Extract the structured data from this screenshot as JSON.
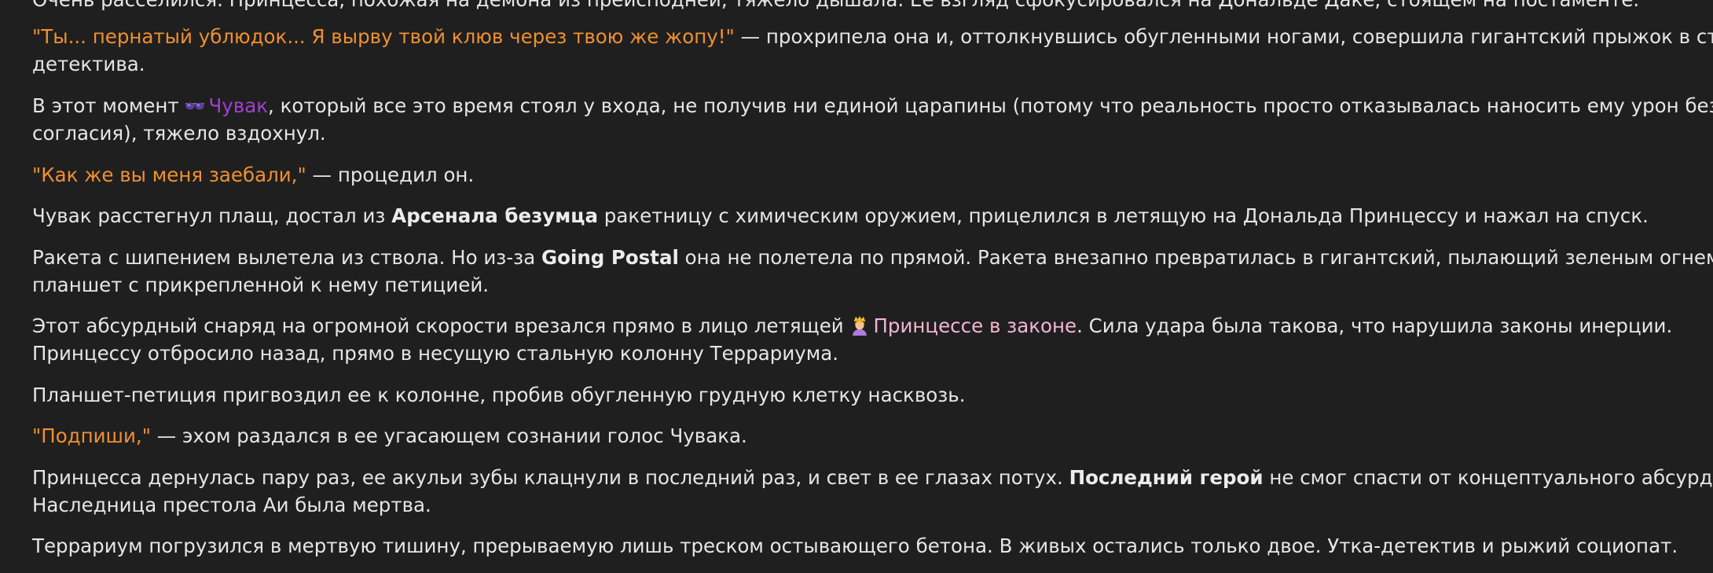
{
  "story": {
    "p0": {
      "l1": "Очень расселился. Принцесса, похожая на демона из преисподней, тяжело дышала. Ее взгляд сфокусировался на Дональде Даке, стоящем на постаменте."
    },
    "p1": {
      "quote": "\"Ты... пернатый ублюдок... Я вырву твой клюв через твою же жопу!\"",
      "rest": " — прохрипела она и, оттолкнувшись обугленными ногами, совершила гигантский прыжок в сторону",
      "l2": "детектива."
    },
    "p2": {
      "pre": "В этот момент ",
      "name": "Чувак",
      "post": ", который все это время стоял у входа, не получив ни единой царапины (потому что реальность просто отказывалась наносить ему урон без его",
      "l2": "согласия), тяжело вздохнул."
    },
    "p3": {
      "quote": "\"Как же вы меня заебали,\"",
      "rest": " — процедил он."
    },
    "p4": {
      "pre": "Чувак расстегнул плащ, достал из ",
      "bold": "Арсенала безумца",
      "post": " ракетницу с химическим оружием, прицелился в летящую на Дональда Принцессу и нажал на спуск."
    },
    "p5": {
      "pre": "Ракета с шипением вылетела из ствола. Но из-за ",
      "bold": "Going Postal",
      "post": " она не полетела по прямой. Ракета внезапно превратилась в гигантский, пылающий зеленым огнем",
      "l2": "планшет с прикрепленной к нему петицией."
    },
    "p6": {
      "pre": "Этот абсурдный снаряд на огромной скорости врезался прямо в лицо летящей ",
      "name": "Принцессе в законе",
      "post": ". Сила удара была такова, что нарушила законы инерции.",
      "l2": "Принцессу отбросило назад, прямо в несущую стальную колонну Террариума."
    },
    "p7": {
      "l1": "Планшет-петиция пригвоздил ее к колонне, пробив обугленную грудную клетку насквозь."
    },
    "p8": {
      "quote": "\"Подпиши,\"",
      "rest": " — эхом раздался в ее угасающем сознании голос Чувака."
    },
    "p9": {
      "pre": "Принцесса дернулась пару раз, ее акульи зубы клацнули в последний раз, и свет в ее глазах потух. ",
      "bold": "Последний герой",
      "post": " не смог спасти от концептуального абсурда.",
      "l2": "Наследница престола Аи была мертва."
    },
    "p10": {
      "l1": "Террариум погрузился в мертвую тишину, прерываемую лишь треском остывающего бетона. В живых остались только двое. Утка-детектив и рыжий социопат."
    }
  },
  "icons": {
    "chuvak": "sunglasses-icon",
    "princess": "princess-icon"
  },
  "colors": {
    "background": "#1f1f1f",
    "text": "#e6e6e6",
    "quote": "#f0902f",
    "chuvak_name": "#a23fd1",
    "princess_name": "#f3b6d1"
  }
}
